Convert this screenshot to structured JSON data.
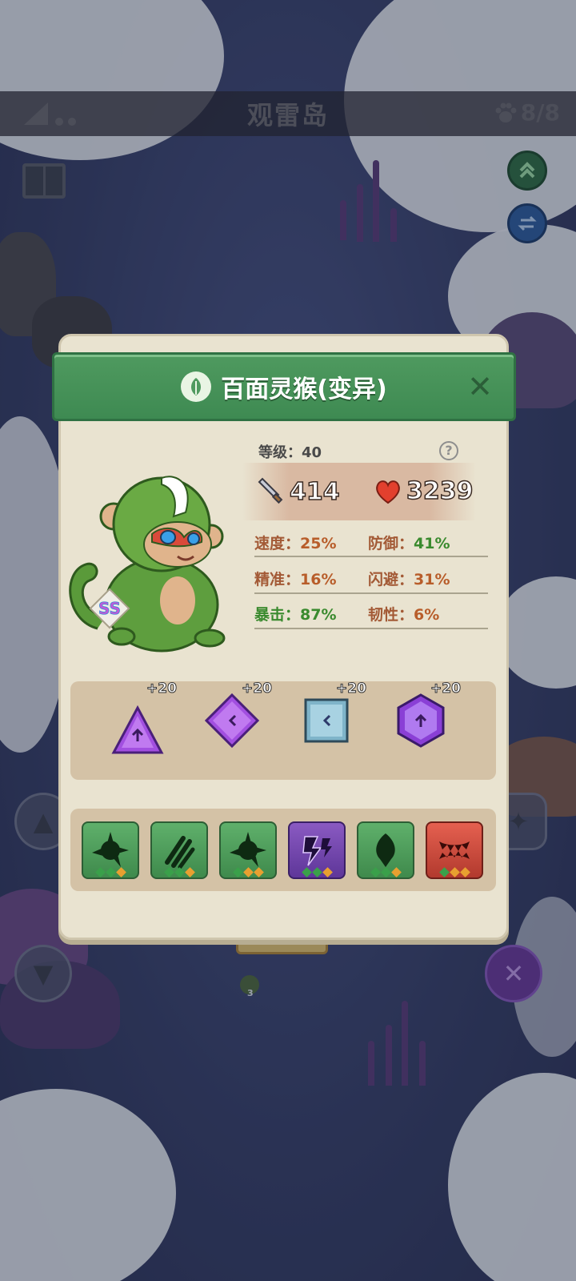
{
  "topbar": {
    "title": "观雷岛",
    "pet_count": "8/8",
    "paw_icon": "paw-icon",
    "signal_icon": "signal-icon"
  },
  "nav": {
    "book_icon": "book-icon",
    "upgrade_icon": "double-chevron-up-icon",
    "swap_icon": "swap-icon"
  },
  "dialog": {
    "name": "百面灵猴(变异)",
    "element_icon": "leaf-icon",
    "rank_badge": "SS",
    "level_label": "等级：",
    "level_value": "40",
    "attack": "414",
    "hp": "3239",
    "stats": [
      {
        "label": "速度：",
        "value": "25%",
        "label_color": "orange",
        "value_color": "orange"
      },
      {
        "label": "防御：",
        "value": "41%",
        "label_color": "orange",
        "value_color": "green"
      },
      {
        "label": "精准：",
        "value": "16%",
        "label_color": "orange",
        "value_color": "orange"
      },
      {
        "label": "闪避：",
        "value": "31%",
        "label_color": "orange",
        "value_color": "orange"
      },
      {
        "label": "暴击：",
        "value": "87%",
        "label_color": "green",
        "value_color": "green"
      },
      {
        "label": "韧性：",
        "value": "6%",
        "label_color": "orange",
        "value_color": "orange"
      }
    ],
    "gems": [
      {
        "bonus": "+20",
        "shape": "triangle",
        "color": "#a24fe0",
        "icon": "up-arrow-icon"
      },
      {
        "bonus": "+20",
        "shape": "diamond",
        "color": "#a24fe0",
        "icon": "left-arrow-icon"
      },
      {
        "bonus": "+20",
        "shape": "square",
        "color": "#7fb4c9",
        "icon": "left-arrow-icon"
      },
      {
        "bonus": "+20",
        "shape": "hexagon",
        "color": "#8a3fd6",
        "icon": "up-arrow-icon"
      }
    ],
    "skills": [
      {
        "icon": "spike-burst-icon",
        "tone": "green"
      },
      {
        "icon": "claw-slash-icon",
        "tone": "green"
      },
      {
        "icon": "spike-burst-icon",
        "tone": "green"
      },
      {
        "icon": "lightning-icon",
        "tone": "purple"
      },
      {
        "icon": "droplet-icon",
        "tone": "green"
      },
      {
        "icon": "fang-icon",
        "tone": "red"
      }
    ]
  },
  "map": {
    "trophy_badge": "3"
  }
}
